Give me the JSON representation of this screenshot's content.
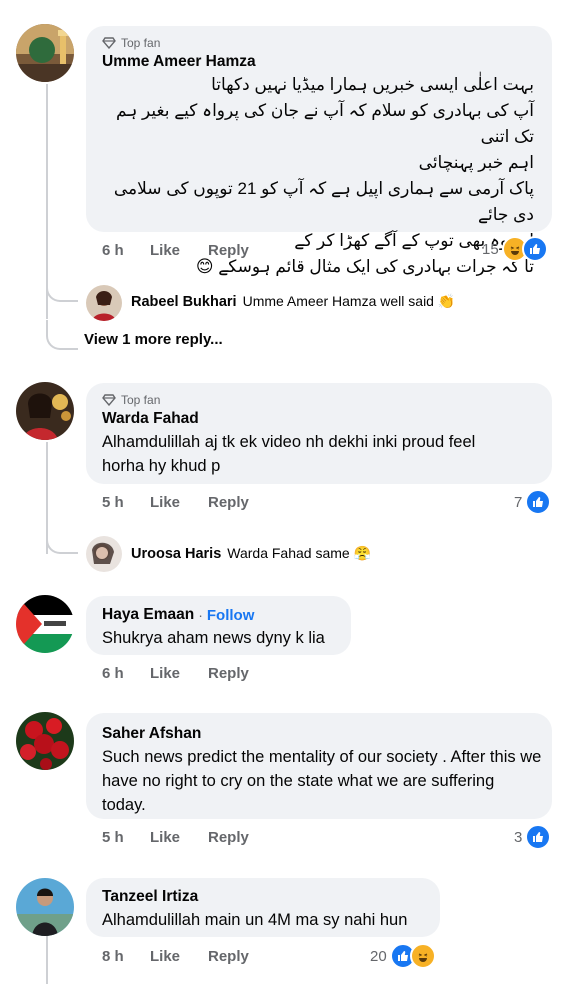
{
  "comments": [
    {
      "badge": "Top fan",
      "author": "Umme Ameer Hamza",
      "lines": [
        "بہت اعلٰی ایسی خبریں ہمارا میڈیا نہیں دکھاتا",
        "آپ کی  بہادری کو سلام کہ آپ نے جان کی پرواہ کیے بغیر ہم تک اتنی",
        "اہم خبر پہنچائی",
        "پاک آرمی سے ہماری اپیل ہے کہ آپ کو 21 توپوں کی سلامی دی جائے",
        "اور وہ بھی توپ کے آگے کھڑا کر کے",
        "تا کہ جرات بہادری کی ایک مثال قائم ہوسکے 😊"
      ],
      "time": "6 h",
      "like": "Like",
      "reply": "Reply",
      "reactions": "15",
      "replies": [
        {
          "author": "Rabeel Bukhari",
          "text": "Umme Ameer Hamza well said 👏"
        }
      ],
      "view_more": "View 1 more reply..."
    },
    {
      "badge": "Top fan",
      "author": "Warda Fahad",
      "text": "Alhamdulillah aj tk ek video nh dekhi inki proud feel horha hy khud p",
      "time": "5 h",
      "like": "Like",
      "reply": "Reply",
      "reactions": "7",
      "replies": [
        {
          "author": "Uroosa Haris",
          "text": "Warda Fahad same 😤"
        }
      ]
    },
    {
      "author": "Haya Emaan",
      "separator": "·",
      "follow": "Follow",
      "text": "Shukrya aham news dyny k lia",
      "time": "6 h",
      "like": "Like",
      "reply": "Reply"
    },
    {
      "author": "Saher Afshan",
      "text": "Such news predict the mentality of our society . After this we have no right to cry on the state what we are suffering today.",
      "time": "5 h",
      "like": "Like",
      "reply": "Reply",
      "reactions": "3"
    },
    {
      "author": "Tanzeel Irtiza",
      "text": "Alhamdulillah main un 4M ma sy nahi hun",
      "time": "8 h",
      "like": "Like",
      "reply": "Reply",
      "reactions": "20"
    }
  ],
  "colors": {
    "like_blue": "#1877f2",
    "bubble": "#f0f2f5",
    "muted": "#65676b",
    "haha_yellow": "#f7b125"
  },
  "icons": [
    "top-fan-diamond-icon",
    "like-reaction-icon",
    "haha-reaction-icon"
  ]
}
